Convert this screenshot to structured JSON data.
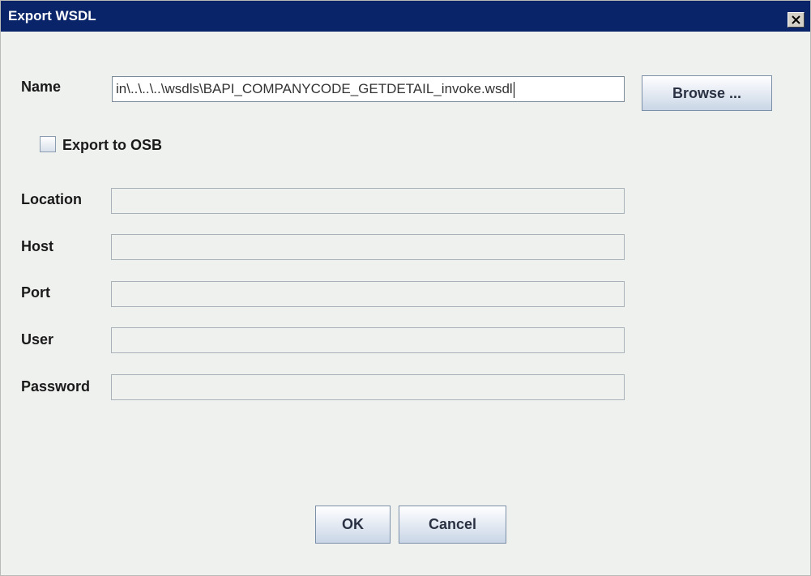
{
  "window": {
    "title": "Export WSDL",
    "close_icon": "close-icon"
  },
  "form": {
    "name_label": "Name",
    "name_value": "in\\..\\..\\..\\wsdls\\BAPI_COMPANYCODE_GETDETAIL_invoke.wsdl",
    "browse_label": "Browse ...",
    "export_osb_label": "Export to OSB",
    "export_osb_checked": false,
    "location_label": "Location",
    "location_value": "",
    "host_label": "Host",
    "host_value": "",
    "port_label": "Port",
    "port_value": "",
    "user_label": "User",
    "user_value": "",
    "password_label": "Password",
    "password_value": ""
  },
  "buttons": {
    "ok_label": "OK",
    "cancel_label": "Cancel"
  },
  "colors": {
    "titlebar": "#0a246a",
    "background": "#eef1ee",
    "button_gradient_bottom": "#c9d6e6"
  }
}
